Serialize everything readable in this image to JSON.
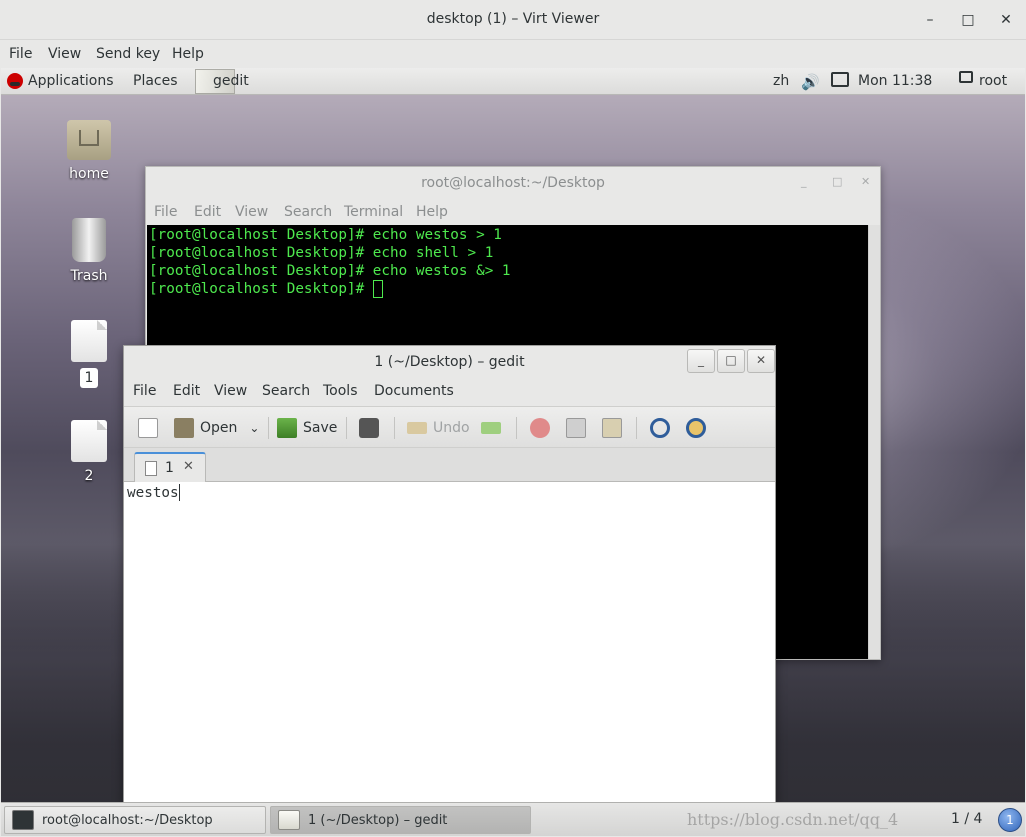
{
  "viewer": {
    "title": "desktop (1) – Virt Viewer",
    "menus": [
      "File",
      "View",
      "Send key",
      "Help"
    ],
    "controls": {
      "minimize": "–",
      "maximize": "□",
      "close": "✕"
    }
  },
  "top_panel": {
    "applications": "Applications",
    "places": "Places",
    "active_app": "gedit",
    "language": "zh",
    "clock": "Mon 11:38",
    "user": "root"
  },
  "desktop_icons": {
    "home": "home",
    "trash": "Trash",
    "file1": "1",
    "file2": "2"
  },
  "terminal": {
    "title": "root@localhost:~/Desktop",
    "menus": [
      "File",
      "Edit",
      "View",
      "Search",
      "Terminal",
      "Help"
    ],
    "lines": [
      "[root@localhost Desktop]# echo westos > 1",
      "[root@localhost Desktop]# echo shell > 1",
      "[root@localhost Desktop]# echo westos &> 1",
      "[root@localhost Desktop]# "
    ],
    "text_color": "#4ee94e"
  },
  "gedit": {
    "title": "1 (~/Desktop) – gedit",
    "menus": [
      "File",
      "Edit",
      "View",
      "Search",
      "Tools",
      "Documents"
    ],
    "toolbar": {
      "open": "Open",
      "save": "Save",
      "undo": "Undo"
    },
    "tab_label": "1",
    "document_text": "westos"
  },
  "taskbar": {
    "tasks": [
      "root@localhost:~/Desktop",
      "1 (~/Desktop) – gedit"
    ],
    "watermark": "https://blog.csdn.net/qq_4",
    "workspace": "1 / 4",
    "workspace_badge": "1"
  }
}
